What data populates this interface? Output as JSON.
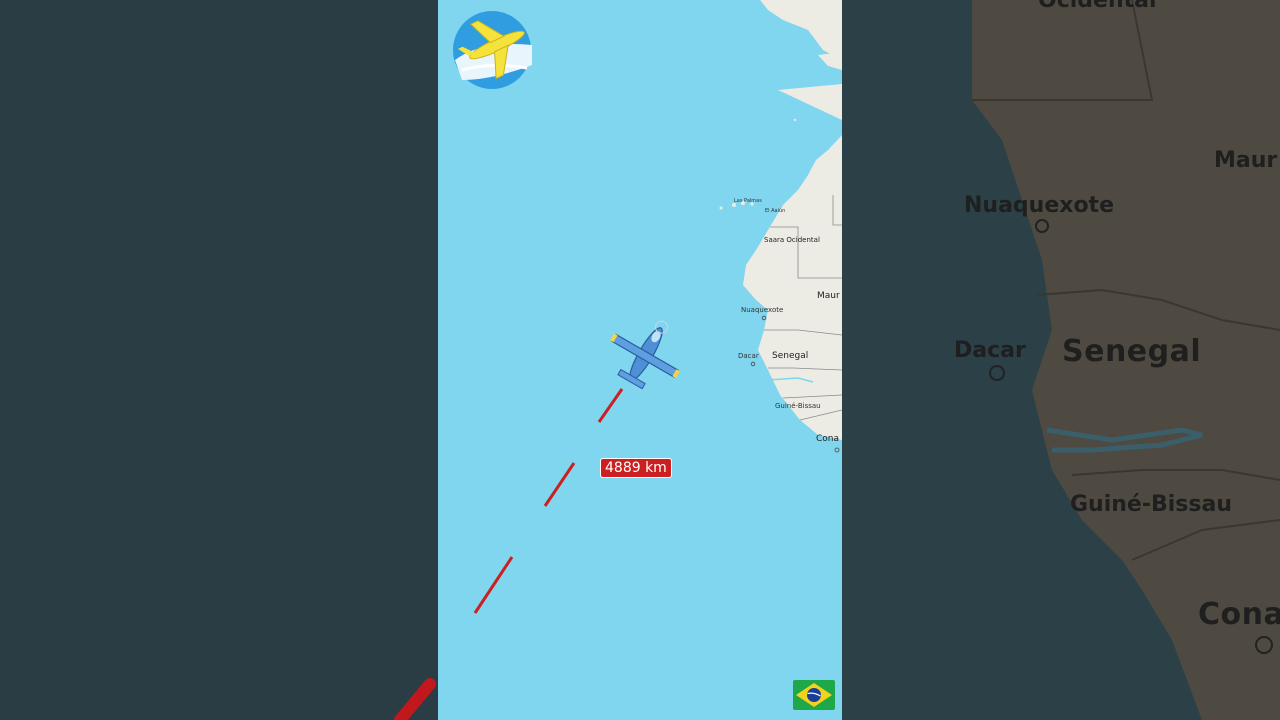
{
  "map": {
    "distance_label": "4889 km",
    "countries": {
      "saara": "Saara Ocidental",
      "maur": "Maur",
      "senegal": "Senegal",
      "guine_bissau": "Guiné-Bissau",
      "cona": "Cona"
    },
    "cities": {
      "nuaquexote": "Nuaquexote",
      "dacar": "Dacar",
      "el_aaiun": "El Aaiún",
      "las_palmas": "Las Palmas"
    },
    "plane_label": "Dacar",
    "colors": {
      "ocean": "#7fd6ee",
      "land": "#ecebe4",
      "route": "#cc1f1f"
    }
  },
  "background_right": {
    "top_label": "Ocidental",
    "maur": "Maur",
    "nuaquexote": "Nuaquexote",
    "dacar": "Dacar",
    "senegal": "Senegal",
    "guine_bissau": "Guiné-Bissau",
    "cona": "Cona"
  },
  "logo": {
    "icon": "airplane-globe-icon"
  },
  "flag": {
    "icon": "brazil-flag-icon"
  }
}
